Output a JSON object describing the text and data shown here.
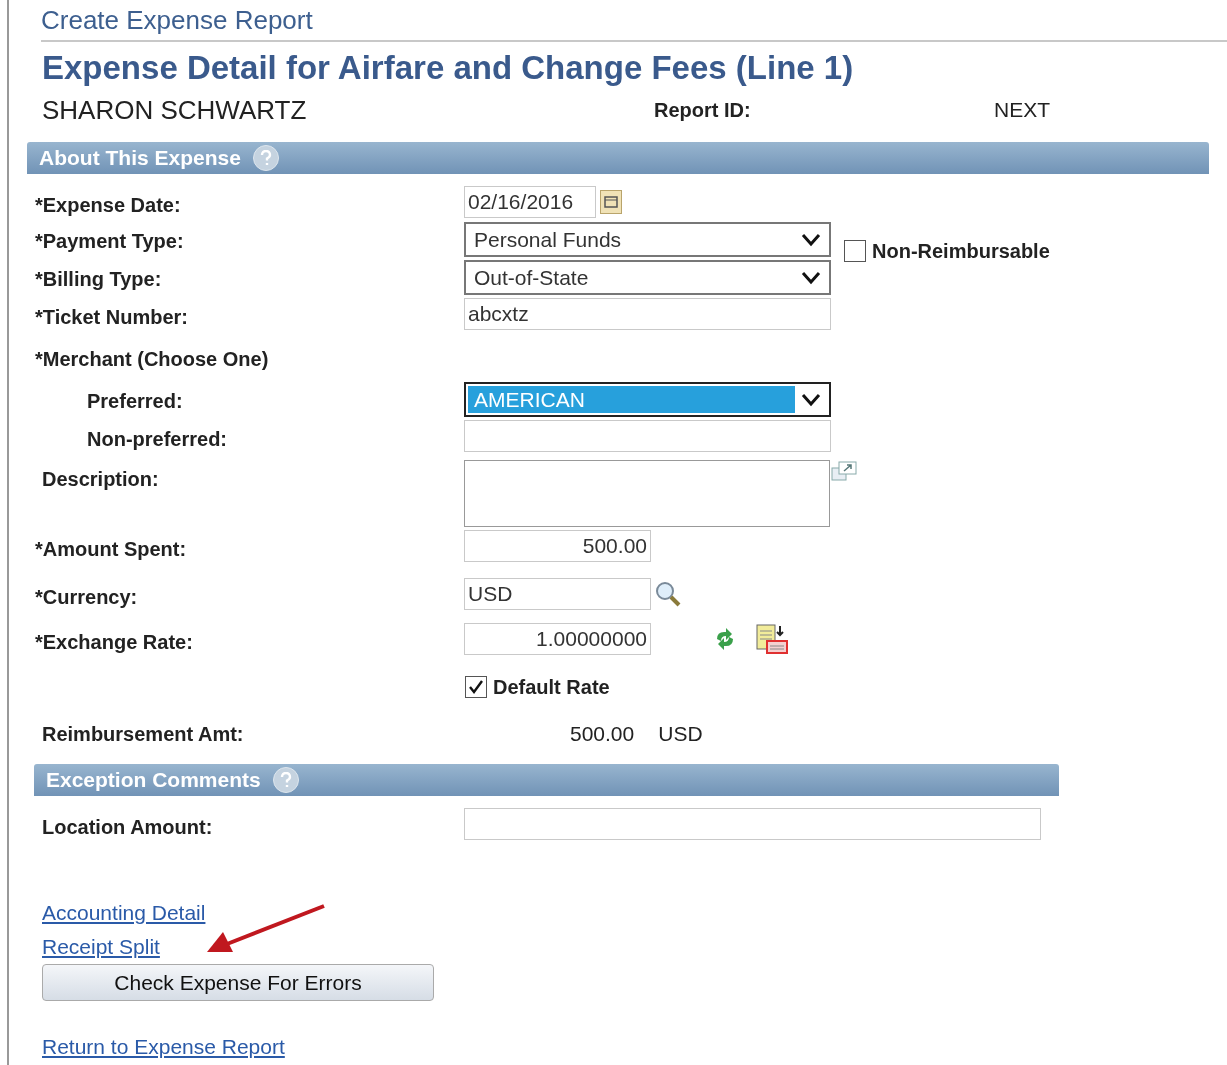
{
  "breadcrumb": "Create Expense Report",
  "title": "Expense Detail for Airfare and Change Fees (Line 1)",
  "employee": "SHARON SCHWARTZ",
  "report_id": {
    "label": "Report ID:",
    "value": "NEXT"
  },
  "non_reimbursable": {
    "label": "Non-Reimbursable",
    "checked": false
  },
  "sections": [
    {
      "title": "About This Expense",
      "fields": [
        {
          "kind": "date",
          "label": "*Expense Date:",
          "value": "02/16/2016"
        },
        {
          "kind": "select",
          "label": "*Payment Type:",
          "value": "Personal Funds",
          "focused": false
        },
        {
          "kind": "select",
          "label": "*Billing Type:",
          "value": "Out-of-State",
          "focused": false
        },
        {
          "kind": "text",
          "label": "*Ticket Number:",
          "value": "abcxtz"
        },
        {
          "kind": "group",
          "label": "*Merchant (Choose One)",
          "children": [
            {
              "kind": "select",
              "label": "Preferred:",
              "value": "AMERICAN",
              "focused": true
            },
            {
              "kind": "text",
              "label": "Non-preferred:"
            }
          ]
        },
        {
          "kind": "textarea",
          "label": "Description:"
        },
        {
          "kind": "amount",
          "label": "*Amount Spent:",
          "value": "500.00"
        },
        {
          "kind": "lookup",
          "label": "*Currency:",
          "value": "USD"
        },
        {
          "kind": "rate",
          "label": "*Exchange Rate:",
          "value": "1.00000000"
        },
        {
          "kind": "checkbox",
          "label": "Default Rate",
          "checked": true
        },
        {
          "kind": "readonly",
          "label": "Reimbursement Amt:",
          "value": "500.00",
          "unit": "USD"
        }
      ]
    },
    {
      "title": "Exception Comments",
      "fields": [
        {
          "kind": "wide_text",
          "label": "Location Amount:"
        }
      ]
    }
  ],
  "links": [
    "Accounting Detail",
    "Receipt Split"
  ],
  "button": "Check Expense For Errors",
  "footer_link": "Return to Expense Report"
}
